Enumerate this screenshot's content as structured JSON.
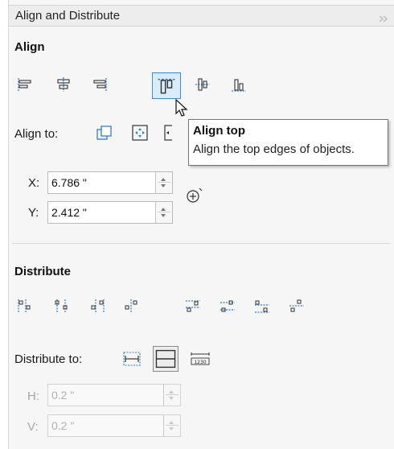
{
  "header": {
    "title": "Align and Distribute"
  },
  "align": {
    "title": "Align",
    "icons": [
      "align-left-icon",
      "align-center-horizontal-icon",
      "align-right-icon",
      "align-top-icon",
      "align-center-vertical-icon",
      "align-bottom-icon"
    ],
    "align_to_label": "Align to:",
    "x_label": "X:",
    "x_value": "6.786 \"",
    "y_label": "Y:",
    "y_value": "2.412 \""
  },
  "tooltip": {
    "title": "Align top",
    "description": "Align the top edges of objects."
  },
  "distribute": {
    "title": "Distribute",
    "distribute_to_label": "Distribute to:",
    "h_label": "H:",
    "h_value": "0.2 \"",
    "v_label": "V:",
    "v_value": "0.2 \""
  },
  "colors": {
    "accent": "#3a8fd6",
    "panel_bg": "#f6f6f6",
    "icon_blue": "#2f7fcf"
  }
}
